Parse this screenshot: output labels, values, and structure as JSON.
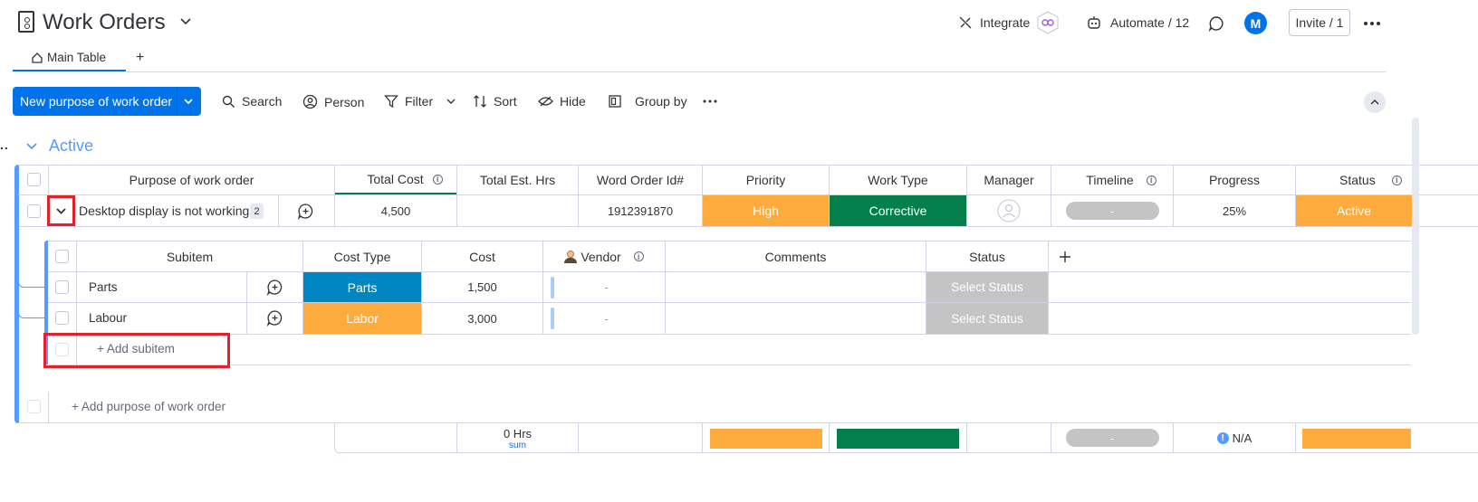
{
  "header": {
    "title": "Work Orders",
    "integrate_label": "Integrate",
    "automate_label": "Automate / 12",
    "avatar_initial": "M",
    "invite_label": "Invite / 1"
  },
  "tabs": [
    {
      "label": "Main Table"
    }
  ],
  "toolbar": {
    "new_item_label": "New purpose of work order",
    "search_label": "Search",
    "person_label": "Person",
    "filter_label": "Filter",
    "sort_label": "Sort",
    "hide_label": "Hide",
    "group_by_label": "Group by"
  },
  "group": {
    "title": "Active",
    "color": "#579bfc",
    "columns": [
      "Purpose of work order",
      "Total Cost",
      "Total Est. Hrs",
      "Word Order Id#",
      "Priority",
      "Work Type",
      "Manager",
      "Timeline",
      "Progress",
      "Status"
    ],
    "row": {
      "name": "Desktop display is not working",
      "subitem_count": "2",
      "total_cost": "4,500",
      "total_est_hrs": "",
      "work_order_id": "1912391870",
      "priority": "High",
      "work_type": "Corrective",
      "timeline": "-",
      "progress": "25%",
      "status": "Active"
    },
    "add_item_label": "+ Add purpose of work order",
    "summary": {
      "hrs": "0 Hrs",
      "hrs_fn": "sum",
      "timeline": "-",
      "progress": "N/A"
    }
  },
  "subitems": {
    "columns": [
      "Subitem",
      "Cost Type",
      "Cost",
      "Vendor",
      "Comments",
      "Status"
    ],
    "rows": [
      {
        "name": "Parts",
        "cost_type": "Parts",
        "cost": "1,500",
        "vendor": "-",
        "comments": "",
        "status": "Select Status"
      },
      {
        "name": "Labour",
        "cost_type": "Labor",
        "cost": "3,000",
        "vendor": "-",
        "comments": "",
        "status": "Select Status"
      }
    ],
    "add_label": "+ Add subitem"
  },
  "colors": {
    "primary": "#0073ea",
    "high": "#fdab3d",
    "corrective": "#037f4c",
    "parts": "#0086c0",
    "labor": "#fdab3d",
    "select_status": "#c4c4c4",
    "annotation": "#e2222b"
  }
}
